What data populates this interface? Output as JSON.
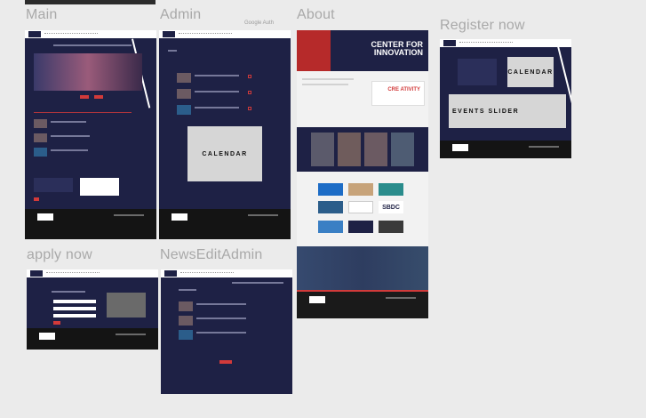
{
  "boards": {
    "main": {
      "label": "Main"
    },
    "admin": {
      "label": "Admin",
      "note": "Google Auth",
      "calendar_label": "CALENDAR"
    },
    "about": {
      "label": "About",
      "hero_title": "CENTER FOR INNOVATION",
      "cre_text": "CRE ATIVITY",
      "sbdc": "SBDC"
    },
    "register": {
      "label": "Register now",
      "calendar_label": "CALENDAR",
      "slider_label": "EVENTS SLIDER"
    },
    "apply": {
      "label": "apply now"
    },
    "news_edit": {
      "label": "NewsEditAdmin"
    }
  }
}
